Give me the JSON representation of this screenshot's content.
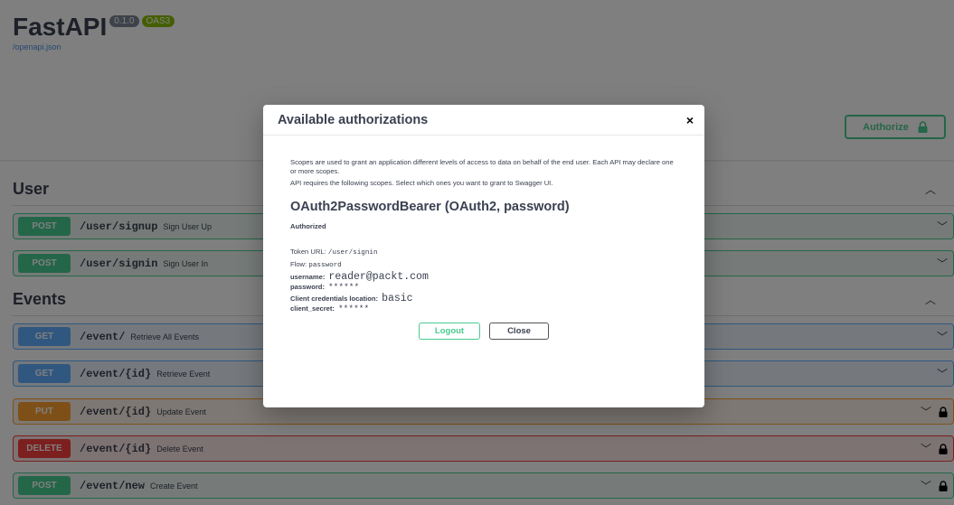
{
  "app": {
    "title": "FastAPI",
    "version": "0.1.0",
    "oas_badge": "OAS3",
    "spec_link": "/openapi.json"
  },
  "authorize_button": {
    "label": "Authorize"
  },
  "sections": [
    {
      "title": "User",
      "ops": [
        {
          "method": "POST",
          "path": "/user/signup",
          "summary": "Sign User Up",
          "locked": false
        },
        {
          "method": "POST",
          "path": "/user/signin",
          "summary": "Sign User In",
          "locked": false
        }
      ]
    },
    {
      "title": "Events",
      "ops": [
        {
          "method": "GET",
          "path": "/event/",
          "summary": "Retrieve All Events",
          "locked": false
        },
        {
          "method": "GET",
          "path": "/event/{id}",
          "summary": "Retrieve Event",
          "locked": false
        },
        {
          "method": "PUT",
          "path": "/event/{id}",
          "summary": "Update Event",
          "locked": true
        },
        {
          "method": "DELETE",
          "path": "/event/{id}",
          "summary": "Delete Event",
          "locked": true
        },
        {
          "method": "POST",
          "path": "/event/new",
          "summary": "Create Event",
          "locked": true
        }
      ]
    }
  ],
  "modal": {
    "title": "Available authorizations",
    "close_glyph": "×",
    "scope_text": "Scopes are used to grant an application different levels of access to data on behalf of the end user. Each API may declare one or more scopes.",
    "scope_text2": "API requires the following scopes. Select which ones you want to grant to Swagger UI.",
    "scheme_title": "OAuth2PasswordBearer (OAuth2, password)",
    "status": "Authorized",
    "token_url_label": "Token URL:",
    "token_url": "/user/signin",
    "flow_label": "Flow:",
    "flow": "password",
    "username_label": "username:",
    "username": "reader@packt.com",
    "password_label": "password:",
    "password": "******",
    "client_location_label": "Client credentials location:",
    "client_location": "basic",
    "client_secret_label": "client_secret:",
    "client_secret": "******",
    "logout_label": "Logout",
    "close_label": "Close"
  },
  "colors": {
    "post": "#49cc90",
    "get": "#61affe",
    "put": "#fca130",
    "delete": "#f93e3e"
  },
  "icons": {
    "lock": "lock-icon",
    "chevron": "chevron-down-icon",
    "collapse": "chevron-up-icon"
  }
}
